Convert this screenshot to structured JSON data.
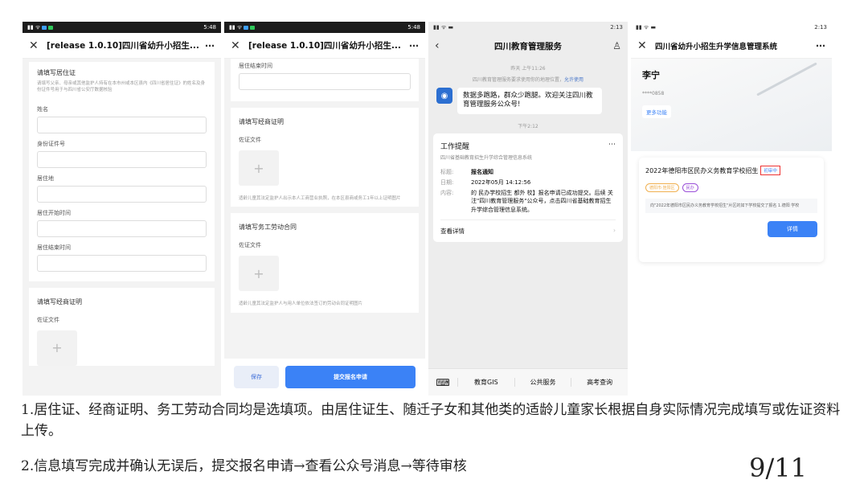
{
  "phone1": {
    "status_time": "5:48",
    "nav_title": "[release 1.0.10]四川省幼升小招生...",
    "section_title": "请填写居住证",
    "hint": "请填写父亲、母亲或其他监护人持有在本市州或本区县内《四川省居住证》的姓名及身份证件号用于与四川省公安厅数据核验",
    "fields": [
      "姓名",
      "身份证件号",
      "居住地",
      "居住开始时间",
      "居住结束时间"
    ],
    "section2_title": "请填写经商证明",
    "upload_label": "佐证文件"
  },
  "phone2": {
    "status_time": "5:48",
    "nav_title": "[release 1.0.10]四川省幼升小招生...",
    "field_top": "居住结束时间",
    "business": {
      "title": "请填写经商证明",
      "upload_label": "佐证文件",
      "hint": "适龄儿童其法定监护人出示本人工商营业执照，在本区县商或务工1年以上证明图片"
    },
    "labor": {
      "title": "请填写务工劳动合同",
      "upload_label": "佐证文件",
      "hint": "适龄儿童其法定监护人与用人单位依法签订的劳动合同证明图片"
    },
    "save_label": "保存",
    "submit_label": "提交报名申请"
  },
  "phone3": {
    "status_time": "2:13",
    "nav_title": "四川教育管理服务",
    "time1": "昨天 上午11:26",
    "location_note": "四川教育管理服务要求使用你的地理位置，",
    "location_allow": "允许使用",
    "welcome_msg": "数据多跑路，群众少跑腿。欢迎关注四川教育管理服务公众号!",
    "time2": "下午2:12",
    "card_title": "工作提醒",
    "card_subtitle": "四川省基础教育招生升学综合管理信息系统",
    "rows": [
      {
        "k": "标题:",
        "v": "报名通知"
      },
      {
        "k": "日期:",
        "v": "2022年05月 14:12:56"
      },
      {
        "k": "内容:",
        "v": "的 民办学校招生 都外 校】报名申请已成功提交。后续 关注\"四川教育管理服务\"公众号，点击四川省基础教育招生升学综合管理信息系统。"
      }
    ],
    "view_detail": "查看详情",
    "menu": [
      "教育GIS",
      "公共服务",
      "高考查询"
    ]
  },
  "phone4": {
    "status_time": "2:13",
    "nav_title": "四川省幼升小招生升学信息管理系统",
    "user_name": "李宁",
    "user_phone": "****0858",
    "more_label": "更多功能",
    "card_title": "2022年德阳市区民办义务教育学校招生",
    "card_status": "初审中",
    "tags": [
      "德阳市·旌阳区",
      "民办"
    ],
    "card_note": "向\"2022年德阳市区民办义务教育学校招生\"片区的如下学校提交了报名 1.德阳 学校",
    "detail_btn": "详情"
  },
  "caption": {
    "line1": "1.居住证、经商证明、务工劳动合同均是选填项。由居住证生、随迁子女和其他类的适龄儿童家长根据自身实际情况完成填写或佐证资料上传。",
    "line2": "2.信息填写完成并确认无误后，提交报名申请→查看公众号消息→等待审核",
    "page": "9/11"
  }
}
